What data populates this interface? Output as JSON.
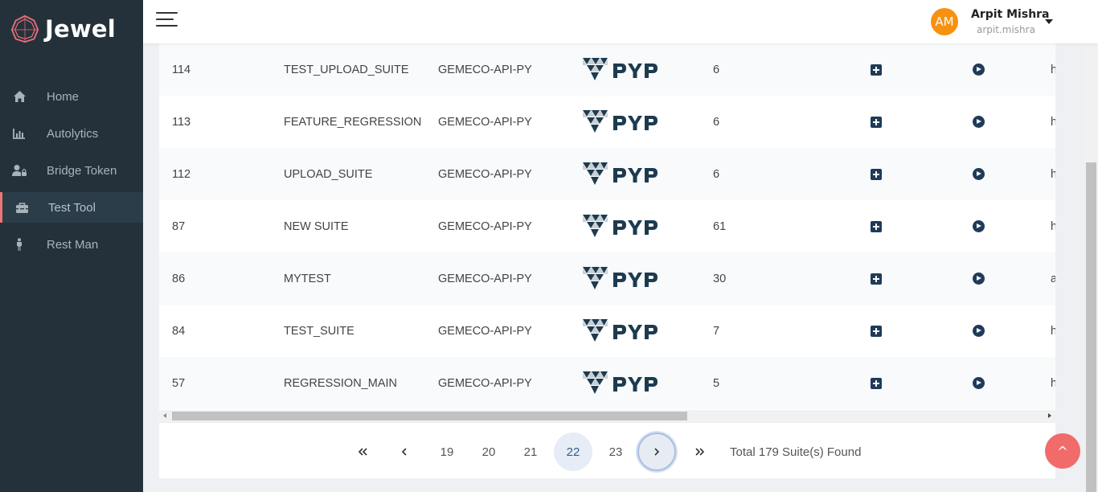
{
  "app": {
    "name": "Jewel"
  },
  "sidebar": {
    "items": [
      {
        "label": "Home",
        "icon": "home-icon",
        "active": false
      },
      {
        "label": "Autolytics",
        "icon": "bar-chart-icon",
        "active": false
      },
      {
        "label": "Bridge Token",
        "icon": "user-lock-icon",
        "active": false
      },
      {
        "label": "Test Tool",
        "icon": "toolbox-icon",
        "active": true
      },
      {
        "label": "Rest Man",
        "icon": "person-icon",
        "active": false
      }
    ]
  },
  "header": {
    "user": {
      "initials": "AM",
      "name": "Arpit Mishra",
      "handle": "arpit.mishra"
    }
  },
  "table": {
    "rows": [
      {
        "id": "114",
        "name": "TEST_UPLOAD_SUITE",
        "project": "GEMECO-API-PY",
        "framework": "PYP",
        "count": "6",
        "more": "h"
      },
      {
        "id": "113",
        "name": "FEATURE_REGRESSION",
        "project": "GEMECO-API-PY",
        "framework": "PYP",
        "count": "6",
        "more": "h"
      },
      {
        "id": "112",
        "name": "UPLOAD_SUITE",
        "project": "GEMECO-API-PY",
        "framework": "PYP",
        "count": "6",
        "more": "h"
      },
      {
        "id": "87",
        "name": "NEW SUITE",
        "project": "GEMECO-API-PY",
        "framework": "PYP",
        "count": "61",
        "more": "h"
      },
      {
        "id": "86",
        "name": "MYTEST",
        "project": "GEMECO-API-PY",
        "framework": "PYP",
        "count": "30",
        "more": "a"
      },
      {
        "id": "84",
        "name": "TEST_SUITE",
        "project": "GEMECO-API-PY",
        "framework": "PYP",
        "count": "7",
        "more": "h"
      },
      {
        "id": "57",
        "name": "REGRESSION_MAIN",
        "project": "GEMECO-API-PY",
        "framework": "PYP",
        "count": "5",
        "more": "h"
      }
    ]
  },
  "pagination": {
    "first_label": "«",
    "prev_label": "‹",
    "pages": [
      "19",
      "20",
      "21",
      "22",
      "23"
    ],
    "current": "22",
    "next_label": "›",
    "last_label": "»",
    "total": "Total 179 Suite(s) Found"
  },
  "scroll_top_label": "^",
  "colors": {
    "sidebar_bg": "#25313a",
    "accent": "#f27474",
    "avatar": "#f7910f",
    "navy": "#1f3b5a",
    "fab": "#f26b6b"
  }
}
